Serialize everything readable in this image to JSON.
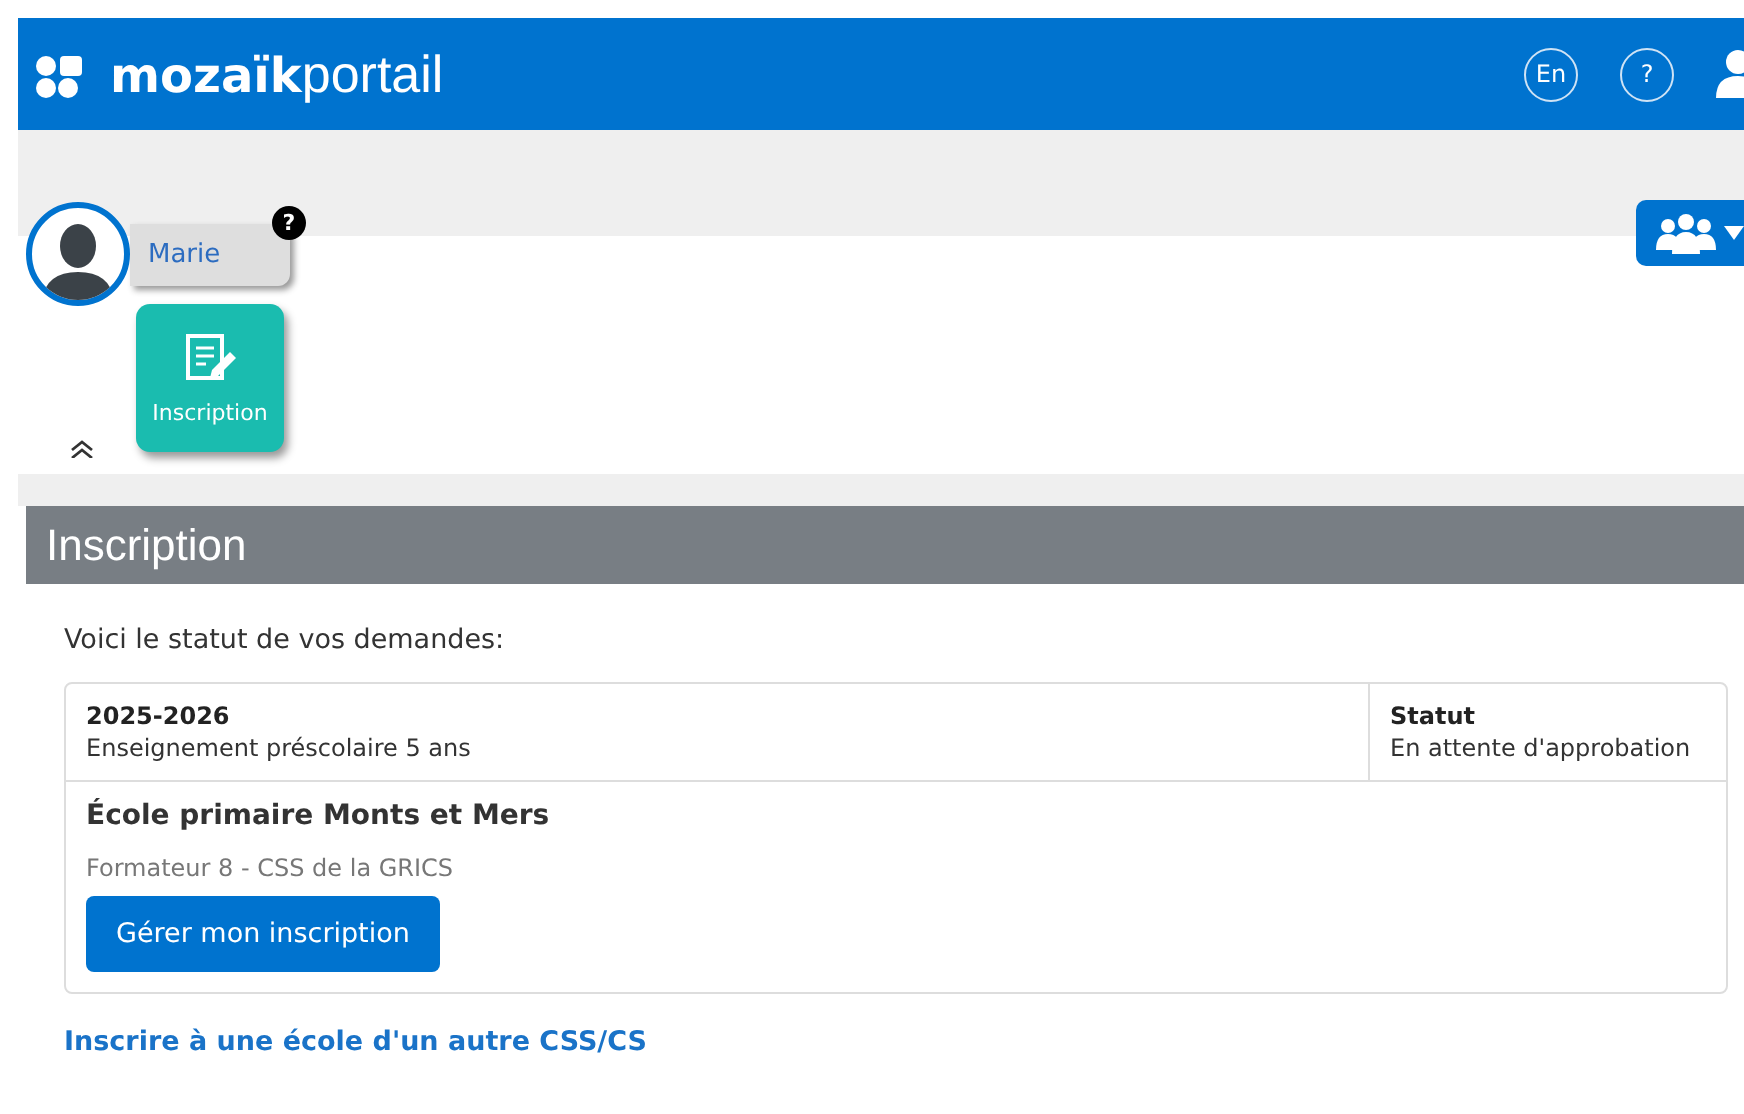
{
  "header": {
    "logo_bold": "mozaïk",
    "logo_light": "portail",
    "language_button": "En",
    "help_button": "?"
  },
  "profile": {
    "name": "Marie",
    "help_badge": "?"
  },
  "apps": [
    {
      "label": "Inscription",
      "selected": true
    }
  ],
  "section": {
    "title": "Inscription",
    "intro": "Voici le statut de vos demandes:",
    "requests": [
      {
        "year": "2025-2026",
        "program": "Enseignement préscolaire 5 ans",
        "status_label": "Statut",
        "status": "En attente d'approbation",
        "school": "École primaire Monts et Mers",
        "organization": "Formateur 8 - CSS de la GRICS",
        "action": "Gérer mon inscription"
      }
    ],
    "link": "Inscrire à une école d'un autre CSS/CS"
  }
}
